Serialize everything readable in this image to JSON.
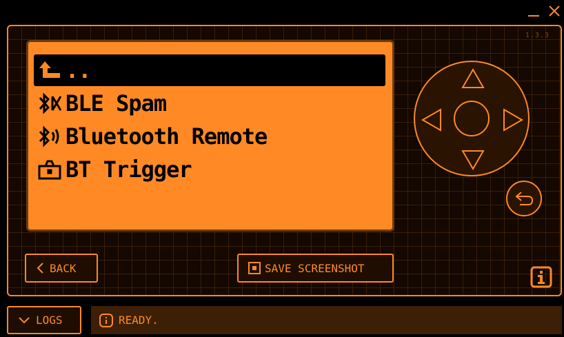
{
  "window": {
    "minimize_icon": "minimize-icon",
    "close_icon": "close-icon"
  },
  "version": "1.3.3",
  "menu": {
    "items": [
      {
        "label": "..",
        "icon": "up-arrow-icon",
        "selected": true
      },
      {
        "label": "BLE Spam",
        "icon": "bluetooth-spam-icon",
        "selected": false
      },
      {
        "label": "Bluetooth Remote",
        "icon": "bluetooth-signal-icon",
        "selected": false
      },
      {
        "label": "BT Trigger",
        "icon": "camera-icon",
        "selected": false
      }
    ]
  },
  "controls": {
    "dpad": [
      "up",
      "down",
      "left",
      "right",
      "ok"
    ],
    "back_icon": "return-arrow-icon"
  },
  "buttons": {
    "back_label": "BACK",
    "screenshot_label": "SAVE SCREENSHOT",
    "logs_label": "LOGS"
  },
  "status": {
    "text": "READY.",
    "icon": "info-icon"
  },
  "colors": {
    "accent": "#ff8a25",
    "screen": "#ff8a25",
    "background": "#000000",
    "grid": "#3a1f08",
    "status_bar": "#3c1f05"
  }
}
